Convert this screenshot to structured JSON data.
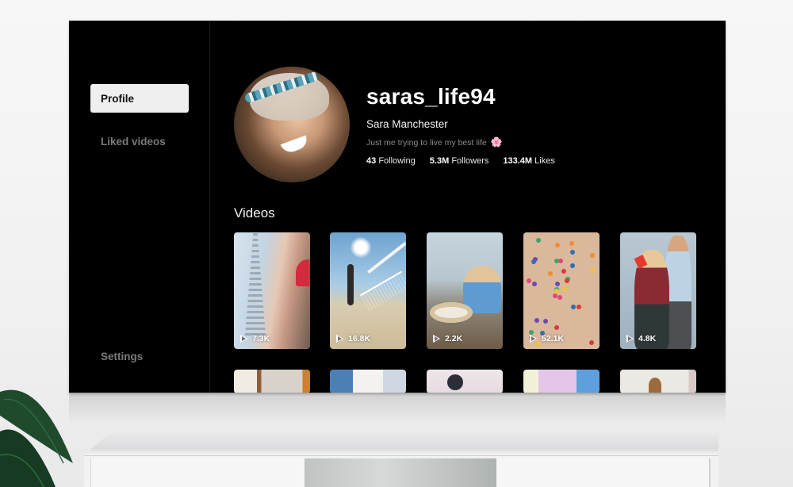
{
  "sidebar": {
    "items": [
      {
        "label": "Profile",
        "active": true
      },
      {
        "label": "Liked videos",
        "active": false
      }
    ],
    "settings_label": "Settings"
  },
  "profile": {
    "username": "saras_life94",
    "full_name": "Sara Manchester",
    "bio": "Just me trying to live my best life",
    "bio_emoji": "🌸",
    "stats": [
      {
        "value": "43",
        "label": "Following"
      },
      {
        "value": "5.3M",
        "label": "Followers"
      },
      {
        "value": "133.4M",
        "label": "Likes"
      }
    ]
  },
  "videos": {
    "heading": "Videos",
    "items": [
      {
        "views": "7.3K",
        "icon": "play-icon"
      },
      {
        "views": "16.8K",
        "icon": "play-icon"
      },
      {
        "views": "2.2K",
        "icon": "play-icon"
      },
      {
        "views": "52.1K",
        "icon": "play-icon"
      },
      {
        "views": "4.8K",
        "icon": "play-icon"
      }
    ]
  }
}
